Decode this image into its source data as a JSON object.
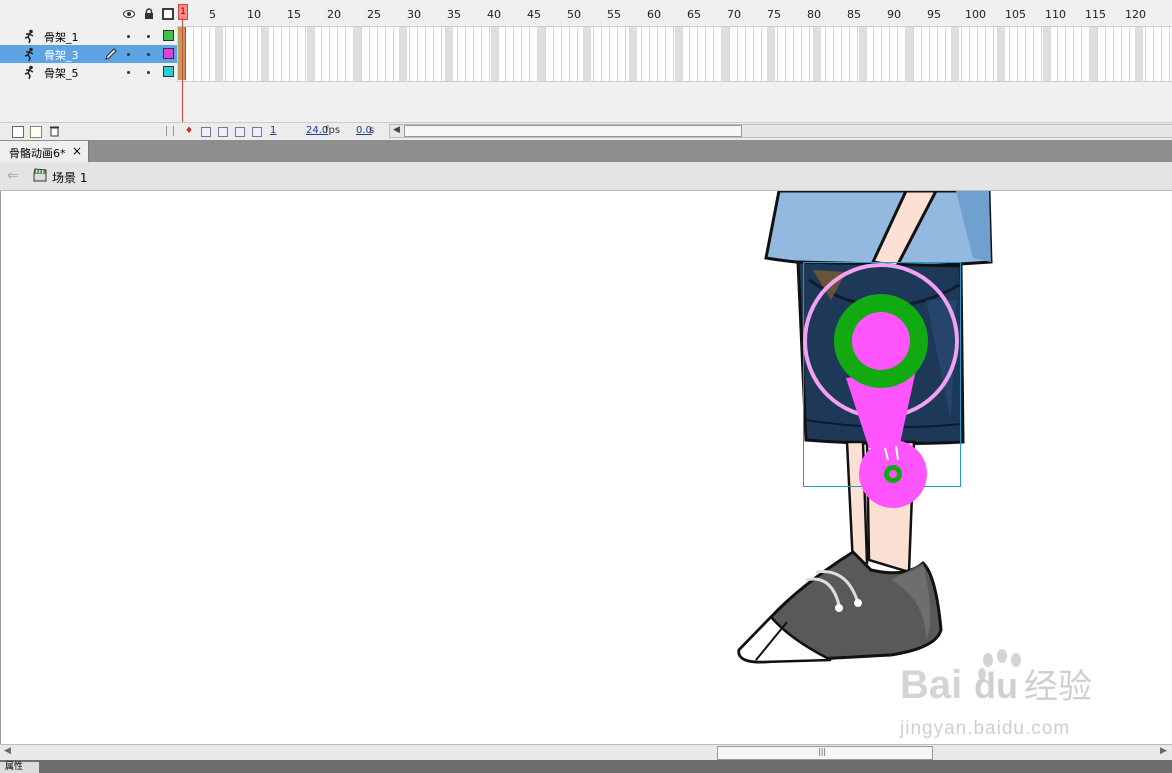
{
  "timeline": {
    "ruler_ticks": [
      "1",
      "5",
      "10",
      "15",
      "20",
      "25",
      "30",
      "35",
      "40",
      "45",
      "50",
      "55",
      "60",
      "65",
      "70",
      "75",
      "80",
      "85",
      "90",
      "95",
      "100",
      "105",
      "110",
      "115",
      "120"
    ],
    "layers": [
      {
        "name": "骨架_1",
        "selected": false,
        "color": "#3ec24a"
      },
      {
        "name": "骨架_3",
        "selected": true,
        "color": "#e040e0"
      },
      {
        "name": "骨架_5",
        "selected": false,
        "color": "#33cccc"
      }
    ],
    "current_frame": "1",
    "fps": "24.0",
    "fps_unit": "fps",
    "elapsed": "0.0",
    "elapsed_unit": "s"
  },
  "document": {
    "tab_label": "骨骼动画6*",
    "tab_close": "×",
    "scene_label": "场景 1"
  },
  "stage": {
    "bone_color": "#ff55ff",
    "joint_color": "#11aa11",
    "selection_color": "#1aa0c8"
  },
  "bottom": {
    "scroll_grip": "|||",
    "properties_tab": "属性"
  },
  "watermark": {
    "logo_text": "Bai经验",
    "url": "jingyan.baidu.com"
  }
}
